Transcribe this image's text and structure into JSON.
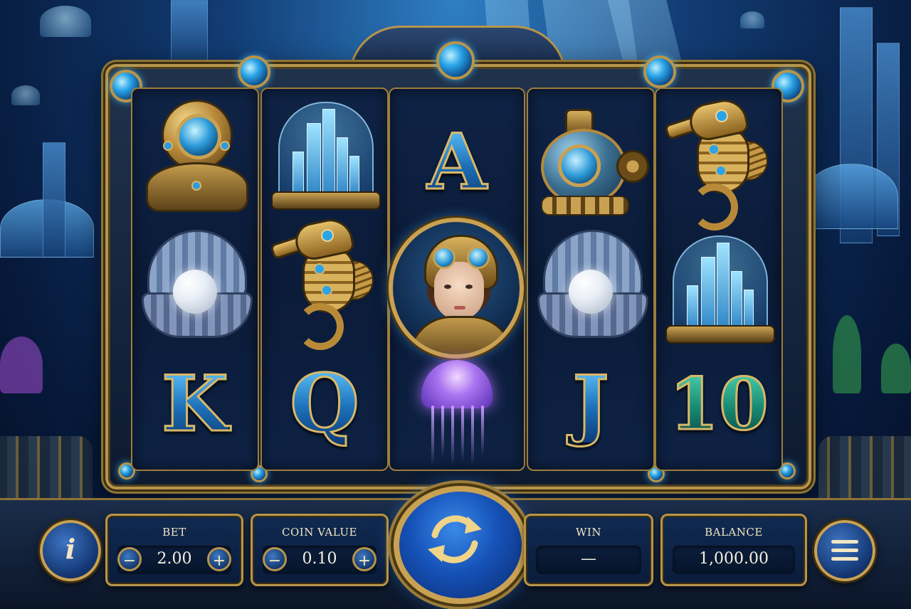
{
  "reels": [
    [
      "diving-helmet",
      "pearl-clam",
      "K"
    ],
    [
      "city-dome",
      "seahorse",
      "Q"
    ],
    [
      "A",
      "diver-woman-wild",
      "jellyfish"
    ],
    [
      "submarine",
      "pearl-clam",
      "J"
    ],
    [
      "seahorse",
      "city-dome",
      "10"
    ]
  ],
  "letters": {
    "k": "K",
    "q": "Q",
    "a": "A",
    "j": "J",
    "ten": "10"
  },
  "controls": {
    "bet": {
      "label": "BET",
      "value": "2.00",
      "minus": "−",
      "plus": "+"
    },
    "coin_value": {
      "label": "COIN VALUE",
      "value": "0.10",
      "minus": "−",
      "plus": "+"
    },
    "win": {
      "label": "WIN",
      "value": "—"
    },
    "balance": {
      "label": "BALANCE",
      "value": "1,000.00"
    },
    "info_icon": "i",
    "menu_icon": "hamburger-menu-icon",
    "spin_icon": "refresh-arrows-icon"
  },
  "colors": {
    "gold": "#c9a152",
    "deep_blue": "#0b1b38",
    "accent_blue": "#2aa4e8"
  }
}
